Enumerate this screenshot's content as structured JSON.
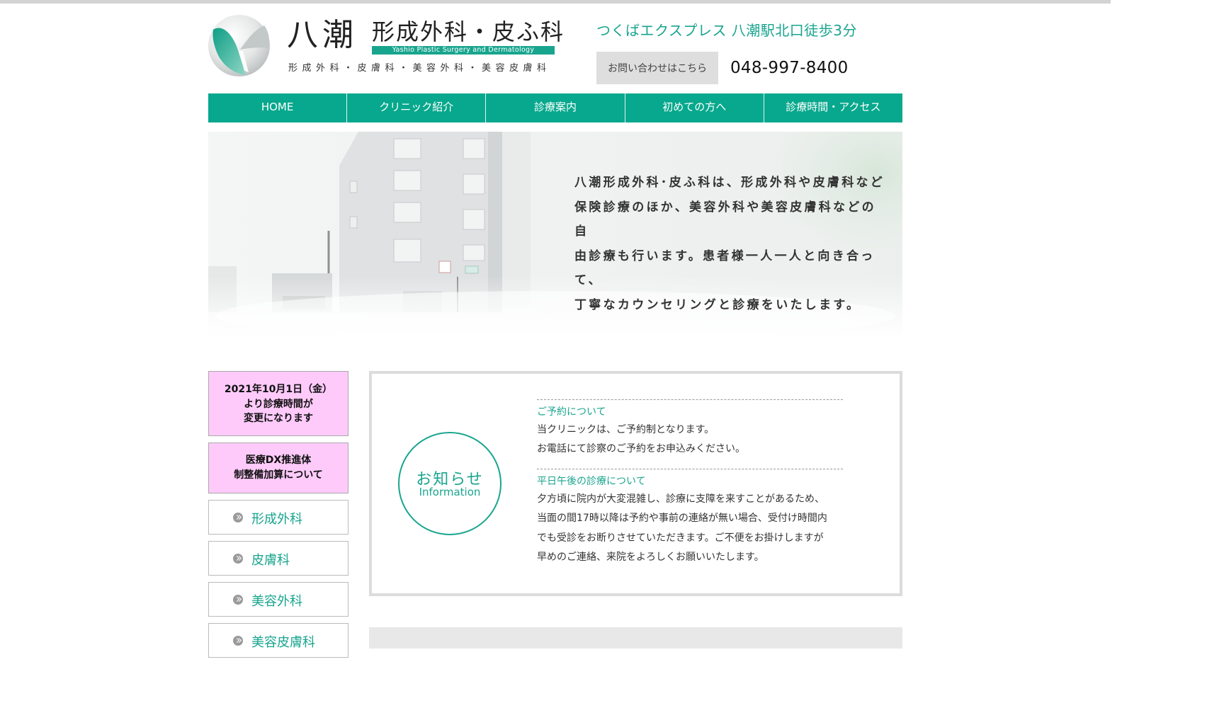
{
  "header": {
    "logo_main": "八潮",
    "logo_sub": "形成外科・皮ふ科",
    "logo_en": "Yashio Plastic Surgery and Dermatology",
    "logo_tagline": "形成外科・皮膚科・美容外科・美容皮膚科",
    "access": "つくばエクスプレス 八潮駅北口徒歩3分",
    "contact_button": "お問い合わせはこちら",
    "phone": "048-997-8400"
  },
  "nav": {
    "items": [
      {
        "label": "HOME"
      },
      {
        "label": "クリニック紹介"
      },
      {
        "label": "診療案内"
      },
      {
        "label": "初めての方へ"
      },
      {
        "label": "診療時間・アクセス"
      }
    ]
  },
  "hero": {
    "lines": [
      "八潮形成外科･皮ふ科は、形成外科や皮膚科など",
      "保険診療のほか、美容外科や美容皮膚科などの自",
      "由診療も行います。患者様一人一人と向き合って、",
      "丁寧なカウンセリングと診療をいたします。"
    ]
  },
  "sidebar": {
    "notice1": [
      "2021年10月1日（金）",
      "より診療時間が",
      "変更になります"
    ],
    "notice2": [
      "医療DX推進体",
      "制整備加算について"
    ],
    "links": [
      {
        "label": "形成外科"
      },
      {
        "label": "皮膚科"
      },
      {
        "label": "美容外科"
      },
      {
        "label": "美容皮膚科"
      }
    ]
  },
  "info": {
    "heading_jp": "お知らせ",
    "heading_en": "Information",
    "items": [
      {
        "title": "ご予約について",
        "body": [
          "当クリニックは、ご予約制となります。",
          "お電話にて診察のご予約をお申込みください。"
        ]
      },
      {
        "title": "平日午後の診療について",
        "body": [
          "夕方頃に院内が大変混雑し、診療に支障を来すことがあるため、",
          "当面の間17時以降は予約や事前の連絡が無い場合、受付け時間内",
          "でも受診をお断りさせていただきます。ご不便をお掛けしますが",
          "早めのご連絡、来院をよろしくお願いいたします。"
        ]
      }
    ]
  },
  "colors": {
    "accent": "#18a58e",
    "nav": "#07a88d",
    "notice": "#fdcafa"
  }
}
